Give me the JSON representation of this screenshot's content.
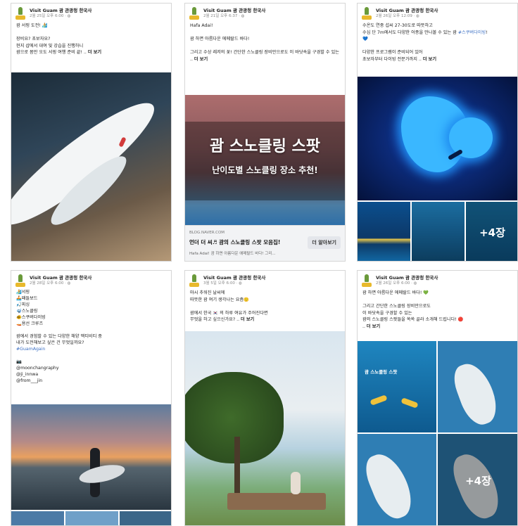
{
  "page_name": "Visit Guam 괌 관광청 한국사",
  "cards": [
    {
      "date": "2월 25일 오후 6:00 · ◍",
      "text": "괌 서핑 도전! 🏄\n\n장비요? 초보자요?\n현지 샵에서 대여 및 강습을 진행하니\n괌으로 몸만 오도 서핑 여행 준비 끝! ..",
      "more": "더 보기"
    },
    {
      "date": "2월 21일 오후 6:37 · ◍",
      "text": "Hafa Adai!\n\n괌 하면 아름다운 에메랄드 바다!\n\n그리고 수상 레저의 꽃! 간단한 스노클링 장비만으로도 이 바닷속을 구경할 수 있는 ..",
      "more": "더 보기",
      "overlay_title": "괌 스노클링 스팟",
      "overlay_sub": "난이도별 스노클링 장소 추천!",
      "link_domain": "BLOG.NAVER.COM",
      "link_title": "언더 더 씨♬ 괌의 스노클링 스팟 모음집!",
      "link_desc": "Hafa Adai! 괌 하면 아름다운 에메랄드 바다! 그리...",
      "link_btn": "더 알아보기"
    },
    {
      "date": "2월 26일 오후 12:09 · ◍",
      "text": "수온도 연중 섭씨 27-30도로 따뜻하고\n수심 단 7m에서도 다양한 어종을 만나볼 수 있는 괌",
      "tag": "#스쿠버다이빙",
      "text2": "!\n💙\n\n다양한 프로그램이 준비되어 있어\n초보자부터 다이빙 전문가까지 ..",
      "more": "더 보기",
      "more_photos": "+4장"
    },
    {
      "date": "2월 28일 오후 6:00 · ◍",
      "text": "🏄서핑\n🚣패들보드\n🎣피싱\n🤿스노클링\n🐠스쿠버다이빙\n🚤용선 크루즈\n\n괌에서 경험할 수 있는 다양한 해양 액티비티 중\n내가 도전해보고 싶은 건 무엇일까요?",
      "tag": "#GuamAgain",
      "text2": "\n\n📷\n@moonchangraphy\n@ji_innwa\n@from___jin"
    },
    {
      "date": "3월 5일 오후 6:00 · ◍",
      "text": "마시 추워진 날씨에\n따뜻한 괌 여기 생각나는 요즘🙂\n\n괌에서 한국 🇰🇷 의 하루 여유가 주어진다면\n무엇을 하고 싶으신가요? ..",
      "more": "더 보기"
    },
    {
      "date": "2월 26일 오후 6:00 · ◍",
      "text": "괌 하면 아름다운 에메랄드 바다! 💚\n\n그리고 간단한 스노클링 장비만으로도\n이 바닷속을 구경할 수 있는\n괌의 스노클링 스팟들을 쏙쏙 골라 소개해 드립니다! 🔴\n.. ",
      "more": "더 보기",
      "guide_title": "괌 스노클링 스팟",
      "more_photos": "+4장"
    }
  ]
}
